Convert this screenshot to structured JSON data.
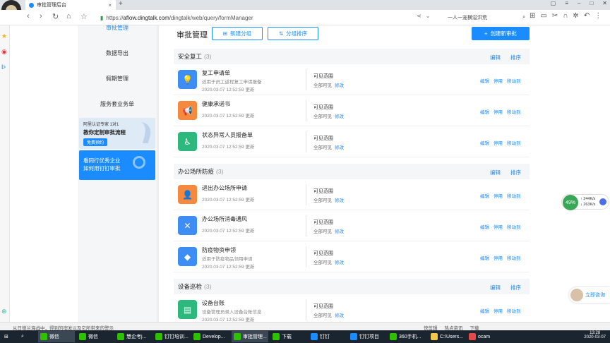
{
  "browser": {
    "tab_title": "审批管理后台",
    "url_prefix": "https://",
    "url_host": "aflow.dingtalk.com",
    "url_path": "/dingtalk/web/query/formManager",
    "search_text": "一人一宠横溢洪荒",
    "new_tab": "+"
  },
  "sidebar": {
    "items": [
      {
        "label": "审批管理"
      },
      {
        "label": "数据导出"
      },
      {
        "label": "假期管理"
      },
      {
        "label": "服务套业务单"
      }
    ],
    "promo1": {
      "small": "阿里认证专家 1对1",
      "big": "教你定制审批流程",
      "btn": "免费预约"
    },
    "promo2": {
      "line1": "看同行优秀企业",
      "line2": "如何用钉钉审批"
    }
  },
  "header": {
    "title": "审批管理",
    "new_group": "新建分组",
    "group_sort": "分组排序",
    "create": "创建新审批"
  },
  "labels": {
    "edit": "编辑",
    "sort": "排序",
    "stop": "停用",
    "move": "移动到",
    "visible_title": "可见范围",
    "visible_all": "全部可见",
    "modify": "修改"
  },
  "groups": [
    {
      "name": "安全复工",
      "count": "(3)",
      "items": [
        {
          "name": "复工申请单",
          "desc": "适用于员工返程复工申请报备",
          "time": "2020.03.07 12:52:59 更新",
          "color": "#3d8df5",
          "icon": "lightbulb-icon"
        },
        {
          "name": "健康承诺书",
          "desc": "",
          "time": "2020.03.07 12:52:59 更新",
          "color": "#f5893d",
          "icon": "megaphone-icon"
        },
        {
          "name": "状态异常人员报备单",
          "desc": "",
          "time": "2020.03.07 12:52:59 更新",
          "color": "#2db87d",
          "icon": "person-icon"
        }
      ]
    },
    {
      "name": "办公场所防疫",
      "count": "(3)",
      "items": [
        {
          "name": "进出办公场所申请",
          "desc": "",
          "time": "2020.03.07 12:52:59 更新",
          "color": "#f5893d",
          "icon": "badge-icon"
        },
        {
          "name": "办公场所消毒通风",
          "desc": "",
          "time": "2020.03.07 12:52:59 更新",
          "color": "#3d8df5",
          "icon": "tools-icon"
        },
        {
          "name": "防疫物资申领",
          "desc": "适用于防疫物品领用申请",
          "time": "2020.03.07 12:52:59 更新",
          "color": "#3d8df5",
          "icon": "handshake-icon"
        }
      ]
    },
    {
      "name": "设备巡检",
      "count": "(3)",
      "items": [
        {
          "name": "设备台账",
          "desc": "设备管理员录入设备台账信息",
          "time": "2020.03.07 12:52:59 更新",
          "color": "#2db87d",
          "icon": "ledger-icon"
        }
      ]
    }
  ],
  "floating": {
    "net_pct": "49%",
    "up": "244K/s",
    "down": "263K/s",
    "consult": "立即咨询"
  },
  "statusbar": {
    "msg": "从日德兰海战中，得到的宿发以及它所带来的警示",
    "quick": "快剪辑",
    "hot": "热点资讯",
    "download": "下载"
  },
  "taskbar": {
    "items": [
      "微信",
      "微信",
      "慧企考j...",
      "钉钉培训...",
      "Develop...",
      "审批管理...",
      "下载",
      "钉钉",
      "钉钉项目",
      "360手机...",
      "C:\\Users...",
      "ocam"
    ],
    "time": "13:28",
    "date": "2020-03-07"
  }
}
